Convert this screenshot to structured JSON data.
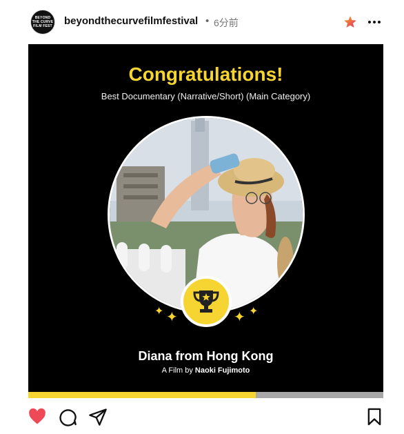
{
  "header": {
    "avatar_lines": [
      "BEYOND",
      "THE CURVE",
      "FILM FEST"
    ],
    "account_name": "beyondthecurvefilmfestival",
    "separator": "•",
    "time_ago": "6分前"
  },
  "post": {
    "title": "Congratulations!",
    "subtitle": "Best Documentary (Narrative/Short) (Main Category)",
    "film_title": "Diana from Hong Kong",
    "credit_prefix": "A Film by",
    "director": "Naoki Fujimoto",
    "accent_color": "#f6d532",
    "background_color": "#000000",
    "carousel_progress": 0.64
  },
  "actions": {
    "like_icon": "heart-icon",
    "comment_icon": "comment-icon",
    "share_icon": "send-icon",
    "save_icon": "bookmark-icon",
    "like_color": "#ed4956"
  }
}
